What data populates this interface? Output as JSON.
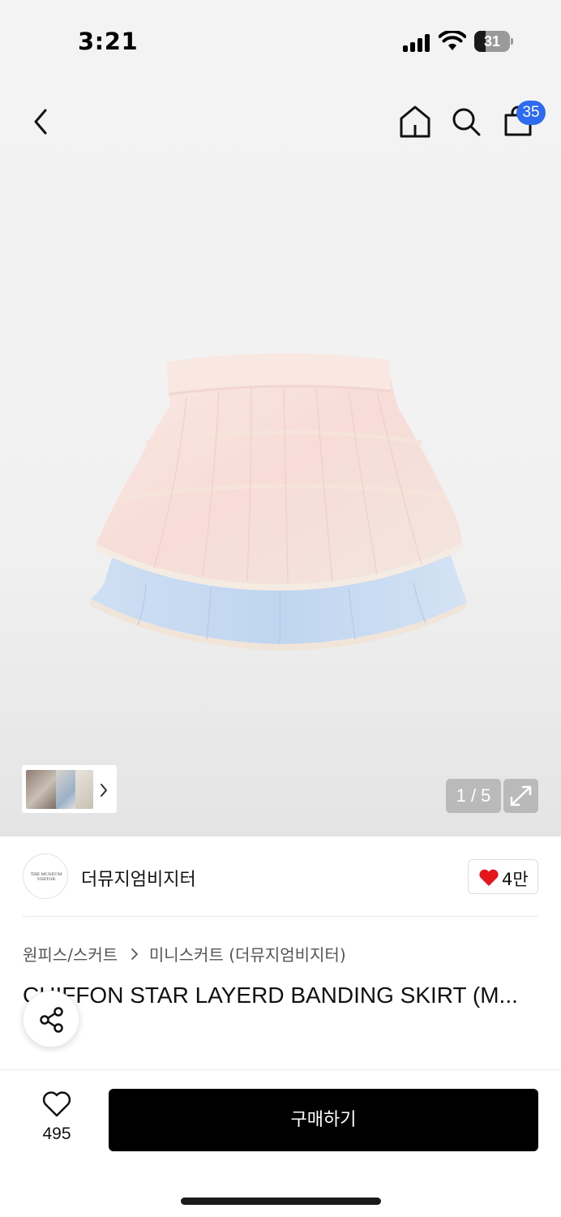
{
  "status_bar": {
    "time": "3:21",
    "battery_level": "31",
    "battery_fraction": 0.31
  },
  "header": {
    "cart_count": "35"
  },
  "gallery": {
    "page_indicator": "1 / 5"
  },
  "brand": {
    "logo_text": "THE MUSEUM VISITOR",
    "name": "더뮤지엄비지터",
    "like_count": "4만"
  },
  "product": {
    "category": "원피스/스커트",
    "subcategory": "미니스커트 (더뮤지엄비지터)",
    "title": "CHIFFON STAR LAYERD BANDING SKIRT (M..."
  },
  "bottom_bar": {
    "wish_count": "495",
    "buy_label": "구매하기"
  },
  "colors": {
    "accent_blue": "#2d6bf0",
    "heart_red": "#e3161b",
    "buy_button": "#000000"
  },
  "icons": [
    "back-icon",
    "home-icon",
    "search-icon",
    "cart-icon",
    "chevron-right-icon",
    "expand-icon",
    "heart-icon",
    "share-icon",
    "heart-outline-icon"
  ]
}
